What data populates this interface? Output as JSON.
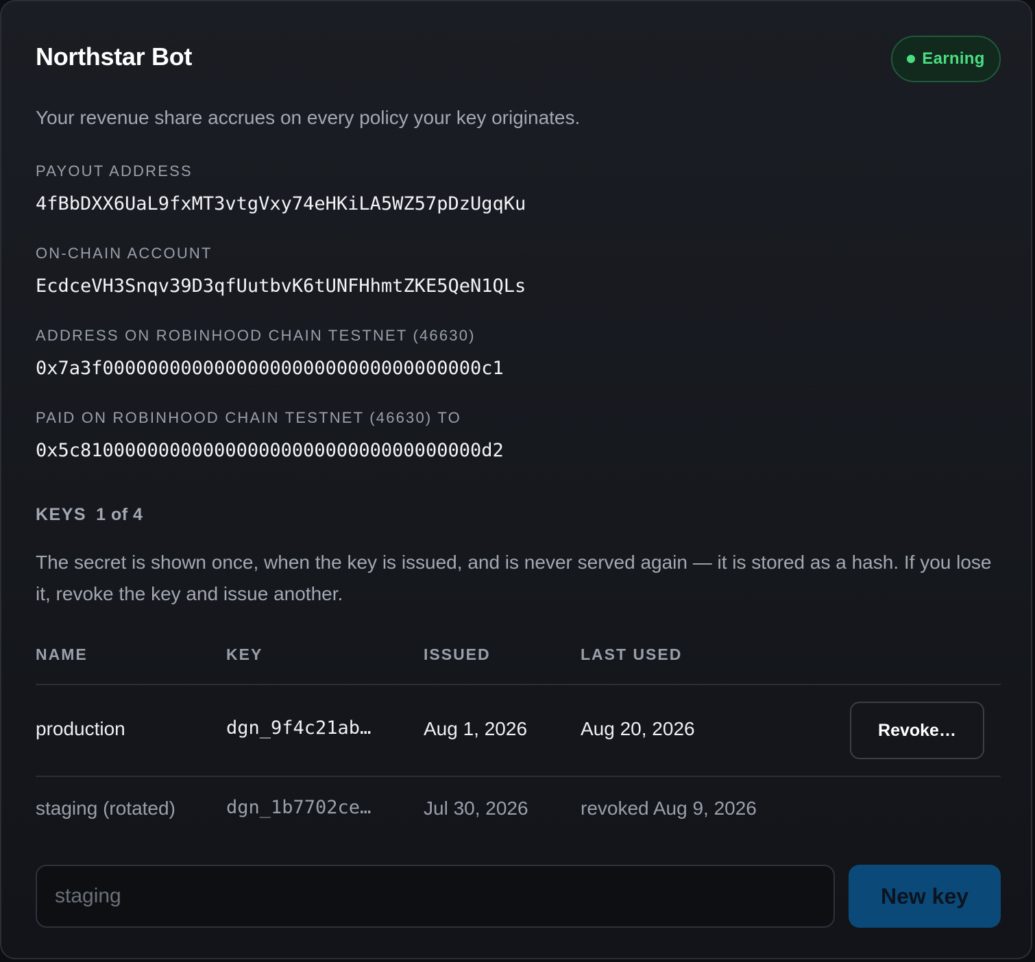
{
  "header": {
    "title": "Northstar Bot",
    "status_badge": "Earning",
    "status_color": "#4ade80"
  },
  "subtitle": "Your revenue share accrues on every policy your key originates.",
  "fields": [
    {
      "label": "PAYOUT ADDRESS",
      "value": "4fBbDXX6UaL9fxMT3vtgVxy74eHKiLA5WZ57pDzUgqKu"
    },
    {
      "label": "ON-CHAIN ACCOUNT",
      "value": "EcdceVH3Snqv39D3qfUutbvK6tUNFHhmtZKE5QeN1QLs"
    },
    {
      "label": "ADDRESS ON ROBINHOOD CHAIN TESTNET (46630)",
      "value": "0x7a3f0000000000000000000000000000000000c1"
    },
    {
      "label": "PAID ON ROBINHOOD CHAIN TESTNET (46630) TO",
      "value": "0x5c810000000000000000000000000000000000d2"
    }
  ],
  "keys": {
    "heading": "KEYS",
    "count": "1 of 4",
    "note": "The secret is shown once, when the key is issued, and is never served again — it is stored as a hash. If you lose it, revoke the key and issue another.",
    "columns": [
      "NAME",
      "KEY",
      "ISSUED",
      "LAST USED"
    ],
    "rows": [
      {
        "name": "production",
        "key": "dgn_9f4c21ab…",
        "issued": "Aug 1, 2026",
        "last_used": "Aug 20, 2026",
        "action": "Revoke…"
      },
      {
        "name": "staging (rotated)",
        "key": "dgn_1b7702ce…",
        "issued": "Jul 30, 2026",
        "last_used": "revoked Aug 9, 2026"
      }
    ]
  },
  "new_key": {
    "input_placeholder": "staging",
    "button_label": "New key",
    "button_color": "#0b4a78"
  }
}
